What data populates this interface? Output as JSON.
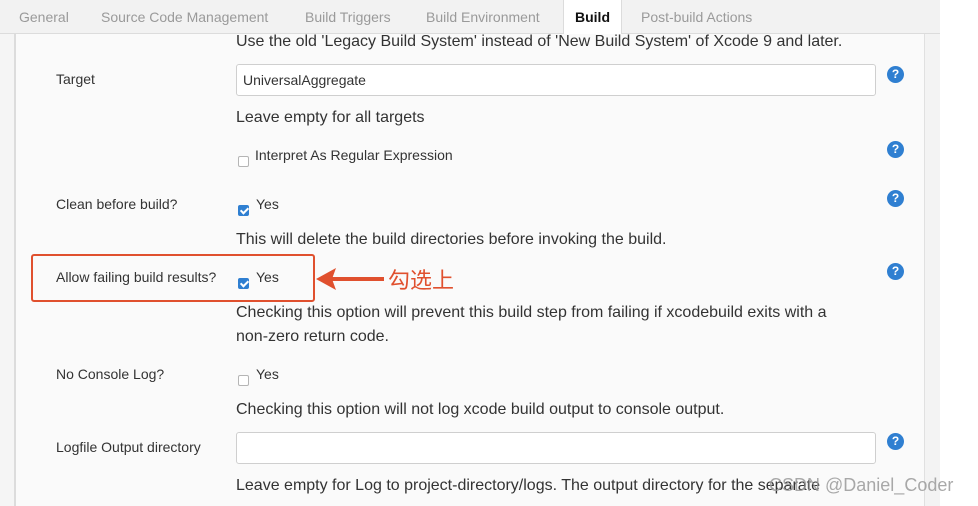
{
  "tabs": {
    "general": "General",
    "source_code_management": "Source Code Management",
    "build_triggers": "Build Triggers",
    "build_environment": "Build Environment",
    "build": "Build",
    "post_build_actions": "Post-build Actions",
    "active": "Build"
  },
  "legacy_build": {
    "description": "Use the old 'Legacy Build System' instead of 'New Build System' of Xcode 9 and later."
  },
  "target": {
    "label": "Target",
    "value": "UniversalAggregate",
    "description": "Leave empty for all targets",
    "regex_label": "Interpret As Regular Expression",
    "regex_checked": false
  },
  "clean_before_build": {
    "label": "Clean before build?",
    "option_label": "Yes",
    "checked": true,
    "description": "This will delete the build directories before invoking the build."
  },
  "allow_failing": {
    "label": "Allow failing build results?",
    "option_label": "Yes",
    "checked": true,
    "description_line1": "Checking this option will prevent this build step from failing if xcodebuild exits with a",
    "description_line2": "non-zero return code."
  },
  "no_console_log": {
    "label": "No Console Log?",
    "option_label": "Yes",
    "checked": false,
    "description": "Checking this option will not log xcode build output to console output."
  },
  "logfile_output": {
    "label": "Logfile Output directory",
    "value": "",
    "description": "Leave empty for Log to project-directory/logs. The output directory for the separate"
  },
  "help_icon_glyph": "?",
  "annotation": {
    "text": "勾选上",
    "color": "#e0502e"
  },
  "watermark": "CSDN @Daniel_Coder",
  "colors": {
    "accent": "#2f7fd1",
    "annotation": "#e0502e",
    "tab_inactive": "#9a9a9a"
  }
}
